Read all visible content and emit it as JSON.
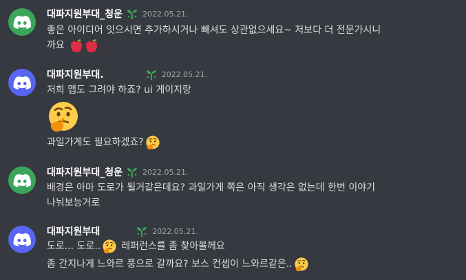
{
  "colors": {
    "background": "#36393f",
    "text": "#dcddde",
    "username": "#ffffff",
    "timestamp": "#a3a6aa",
    "avatar_green": "#3ba55c",
    "avatar_blurple": "#5865f2",
    "sprout": "#3ba55c"
  },
  "messages": [
    {
      "username": "대파지원부대_청운",
      "timestamp": "2022.05.21.",
      "avatar_icon": "discord-logo-icon",
      "lines": [
        "좋은 아이디어 잇으시면 추가하시거나 빼셔도 상관없으세요~ 저보다 더 전문가시니",
        "까요"
      ],
      "emoji": "red-apple-icon"
    },
    {
      "username": "대파지원부대.",
      "timestamp": "2022.05.21.",
      "avatar_icon": "discord-logo-icon",
      "lines": [
        "저희 맵도 그려야 하죠? ui 게이지랑",
        "과일가게도 필요하겠죠?"
      ],
      "emoji": "thinking-face-icon"
    },
    {
      "username": "대파지원부대_청운",
      "timestamp": "2022.05.21.",
      "avatar_icon": "discord-logo-icon",
      "lines": [
        "배경은 아마 도로가 될거같은데요? 과일가게 쪽은 아직 생각은 없는데 한번 이야기",
        "나눠보능거로"
      ]
    },
    {
      "username": "대파지원부대",
      "timestamp": "2022.05.21.",
      "avatar_icon": "discord-logo-icon",
      "lines": [
        "도로... 도로..",
        "레퍼런스를 좀 찾아볼께요",
        "좀 간지나게 느와르 풍으로 갈까요? 보스 컨셉이 느와르같은.."
      ],
      "emoji": "thinking-face-icon"
    }
  ]
}
